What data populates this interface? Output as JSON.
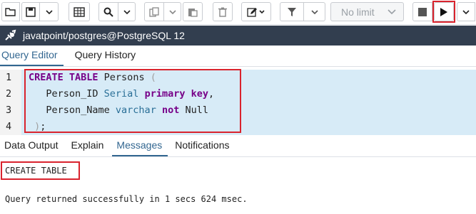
{
  "toolbar": {
    "buttons": [
      {
        "name": "open-file-icon",
        "glyph": "📂"
      },
      {
        "name": "save-icon",
        "glyph": "💾"
      },
      {
        "name": "chevron-down-icon",
        "glyph": "⌄"
      },
      {
        "name": "edit-grid-icon",
        "glyph": "▦"
      },
      {
        "name": "find-icon",
        "glyph": "🔍"
      },
      {
        "name": "copy-icon",
        "glyph": "⎘"
      },
      {
        "name": "paste-icon",
        "glyph": "📋"
      },
      {
        "name": "delete-icon",
        "glyph": "🗑"
      },
      {
        "name": "edit-pencil-icon",
        "glyph": "✎"
      },
      {
        "name": "filter-icon",
        "glyph": "▼"
      },
      {
        "name": "stop-icon",
        "glyph": "■"
      },
      {
        "name": "execute-icon",
        "glyph": "▶"
      }
    ],
    "limit_label": "No limit",
    "highlight_color": "#d9232d"
  },
  "connection": {
    "label": "javatpoint/postgres@PostgreSQL 12",
    "bg_color": "#323e4f"
  },
  "tabs": [
    {
      "label": "Query Editor",
      "active": true
    },
    {
      "label": "Query History",
      "active": false
    }
  ],
  "editor": {
    "line_numbers": [
      "1",
      "2",
      "3",
      "4"
    ],
    "lines": [
      [
        {
          "t": "CREATE TABLE",
          "c": "kw"
        },
        {
          "t": " Persons ",
          "c": ""
        },
        {
          "t": "(",
          "c": "br"
        }
      ],
      [
        {
          "t": "   Person_ID ",
          "c": ""
        },
        {
          "t": "Serial",
          "c": "ty"
        },
        {
          "t": " ",
          "c": ""
        },
        {
          "t": "primary key",
          "c": "kw"
        },
        {
          "t": ",",
          "c": ""
        }
      ],
      [
        {
          "t": "   Person_Name ",
          "c": ""
        },
        {
          "t": "varchar",
          "c": "ty"
        },
        {
          "t": " ",
          "c": ""
        },
        {
          "t": "not",
          "c": "kw"
        },
        {
          "t": " Null",
          "c": ""
        }
      ],
      [
        {
          "t": " ",
          "c": ""
        },
        {
          "t": ")",
          "c": "br"
        },
        {
          "t": ";",
          "c": ""
        }
      ]
    ]
  },
  "bottom_tabs": [
    {
      "label": "Data Output",
      "active": false
    },
    {
      "label": "Explain",
      "active": false
    },
    {
      "label": "Messages",
      "active": true
    },
    {
      "label": "Notifications",
      "active": false
    }
  ],
  "messages": {
    "result": "CREATE TABLE",
    "status": "Query returned successfully in 1 secs 624 msec."
  }
}
